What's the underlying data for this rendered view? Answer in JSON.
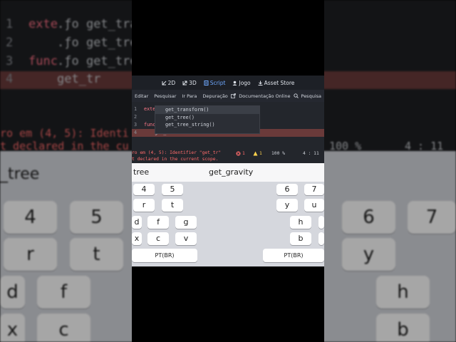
{
  "background": {
    "code_lines": [
      {
        "num": "1",
        "kw": "exte",
        "txt": ".ƒo  get_trans"
      },
      {
        "num": "2",
        "kw": "",
        "txt": ".ƒo  get_tree"
      },
      {
        "num": "3",
        "kw": "func",
        "txt": ".ƒo  get_tree"
      },
      {
        "num": "4",
        "kw": "",
        "txt": "    get_tr"
      }
    ],
    "error_line1": "ro em (4, 5): Identi",
    "error_line2": "t declared in the cu",
    "zoom": "100 %",
    "position": "4 :  11",
    "suggestion": "_tree",
    "keys": [
      "4",
      "5",
      "6",
      "7",
      "r",
      "t",
      "y",
      "d",
      "f",
      "h",
      "x",
      "c",
      "b"
    ]
  },
  "godot": {
    "toolbar": [
      {
        "icon": "2d-icon",
        "label": "2D",
        "active": false
      },
      {
        "icon": "3d-icon",
        "label": "3D",
        "active": false
      },
      {
        "icon": "script-icon",
        "label": "Script",
        "active": true
      },
      {
        "icon": "game-icon",
        "label": "Jogo",
        "active": false
      },
      {
        "icon": "asset-store-icon",
        "label": "Asset Store",
        "active": false
      }
    ],
    "menu": [
      "Editar",
      "Pesquisar",
      "Ir Para",
      "Depuração"
    ],
    "doc_link": "Documentação Online",
    "search_help": "Pesquisa",
    "editor_lines": [
      {
        "num": "1",
        "kw": "exte",
        "txt": "get_transform()"
      },
      {
        "num": "2",
        "kw": "",
        "txt": "get_tree()"
      },
      {
        "num": "3",
        "kw": "func",
        "txt": "get_tree_string()"
      },
      {
        "num": "4",
        "kw": "",
        "txt": "get_tr"
      }
    ],
    "autocomplete": [
      {
        "icon": "ƒ",
        "text": "get_transform()",
        "selected": true
      },
      {
        "icon": "ƒ",
        "text": "get_tree()",
        "selected": false
      },
      {
        "icon": "ƒ",
        "text": "get_tree_string()",
        "selected": false
      }
    ],
    "status": {
      "error_line1": "ro em (4, 5): Identifier \"get_tr\"",
      "error_line2": "t declared in the current scope.",
      "errors": "1",
      "warnings": "1",
      "zoom": "100 %",
      "position": "4 :  11"
    }
  },
  "keyboard": {
    "suggestions": [
      "tree",
      "get_gravity"
    ],
    "row_numbers": [
      "4",
      "5",
      "6",
      "7"
    ],
    "row_top": [
      "r",
      "t",
      "y",
      "u"
    ],
    "row_mid": [
      "d",
      "f",
      "g",
      "h"
    ],
    "row_bottom": [
      "x",
      "c",
      "v",
      "b"
    ],
    "language": "PT(BR)"
  },
  "colors": {
    "accent": "#6ea8ff",
    "error": "#ff6b6b",
    "warning": "#ffd34d",
    "keyword": "#ff7a8a"
  }
}
